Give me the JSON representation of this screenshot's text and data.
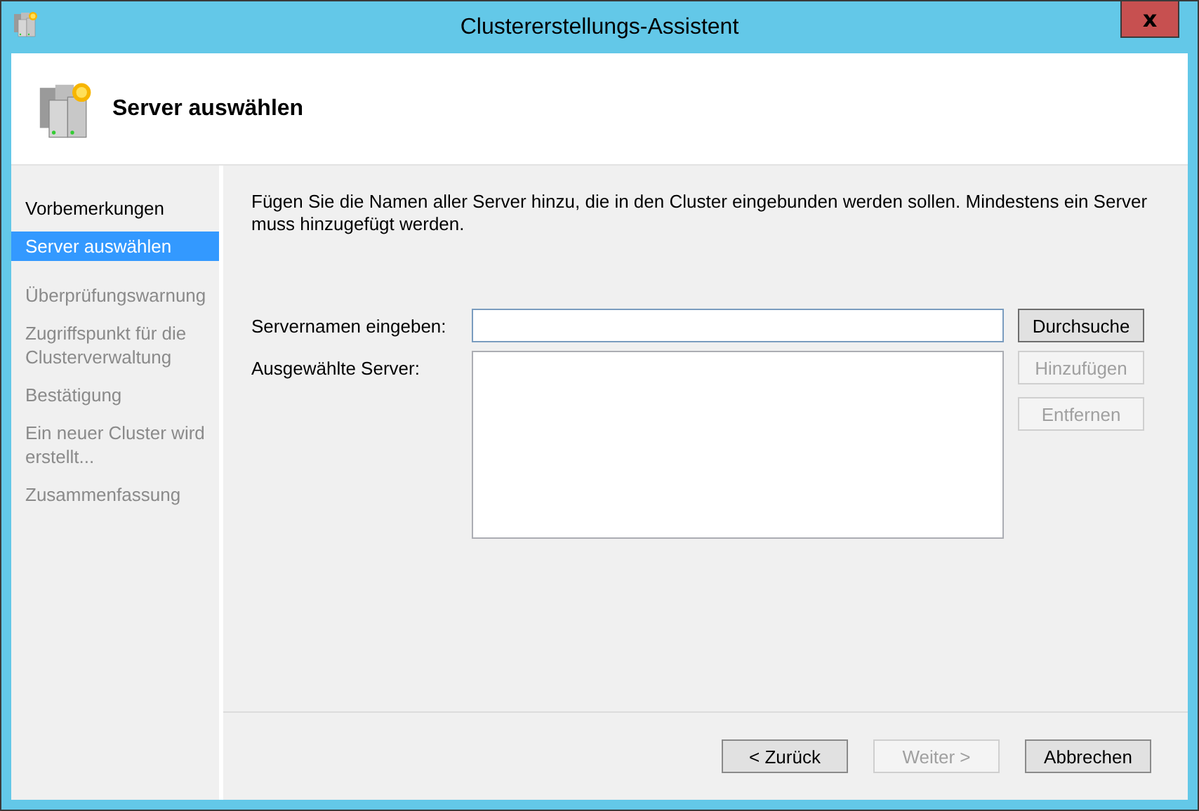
{
  "window": {
    "title": "Clustererstellungs-Assistent",
    "close": "x"
  },
  "header": {
    "title": "Server auswählen"
  },
  "steps": [
    {
      "label": "Vorbemerkungen",
      "selected": false,
      "disabled": false
    },
    {
      "label": "Server auswählen",
      "selected": true,
      "disabled": false
    },
    {
      "label": "Überprüfungswarnung",
      "selected": false,
      "disabled": true
    },
    {
      "label": "Zugriffspunkt für die Clusterverwaltung",
      "selected": false,
      "disabled": true
    },
    {
      "label": "Bestätigung",
      "selected": false,
      "disabled": true
    },
    {
      "label": "Ein neuer Cluster wird erstellt...",
      "selected": false,
      "disabled": true
    },
    {
      "label": "Zusammenfassung",
      "selected": false,
      "disabled": true
    }
  ],
  "description": "Fügen Sie die Namen aller Server hinzu, die in den Cluster eingebunden werden sollen. Mindestens ein Server muss hinzugefügt werden.",
  "server_name": {
    "label": "Servernamen eingeben:",
    "browse": {
      "label": "Durchsuche",
      "disabled": false,
      "default": true
    }
  },
  "selected_servers": {
    "label": "Ausgewählte Server:"
  },
  "side_buttons": [
    {
      "label": "Hinzufügen",
      "disabled": true
    },
    {
      "label": "Entfernen",
      "disabled": true
    }
  ],
  "footer_buttons": [
    {
      "label": "< Zurück",
      "disabled": false
    },
    {
      "label": "Weiter >",
      "disabled": true
    },
    {
      "label": "Abbrechen",
      "disabled": false
    }
  ]
}
